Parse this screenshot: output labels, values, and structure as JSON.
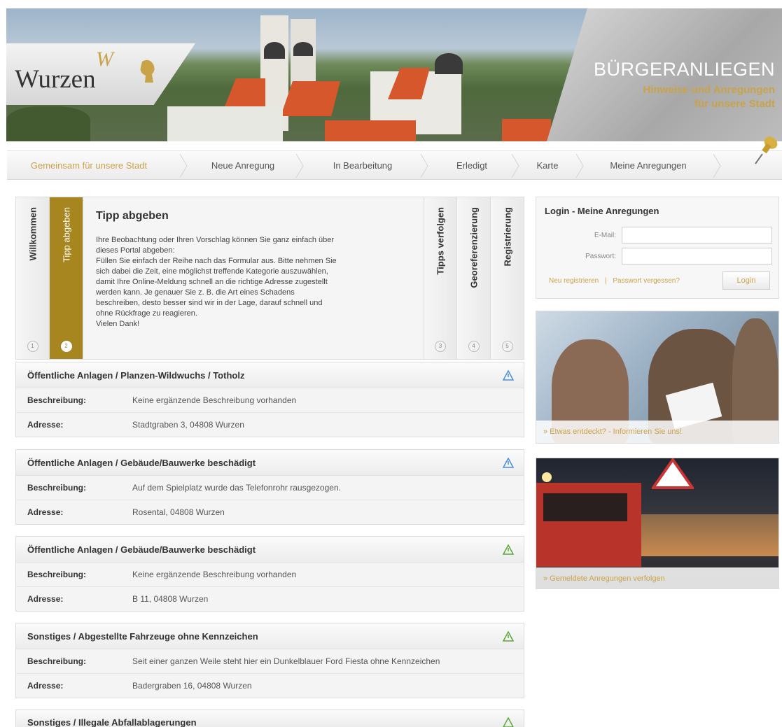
{
  "header": {
    "logo_text": "Wurzen",
    "title": "BÜRGERANLIEGEN",
    "subtitle_1": "Hinweise und Anregungen",
    "subtitle_2": "für unsere Stadt"
  },
  "nav": {
    "items": [
      {
        "label": "Gemeinsam für unsere Stadt",
        "active": true
      },
      {
        "label": "Neue Anregung"
      },
      {
        "label": "In Bearbeitung"
      },
      {
        "label": "Erledigt"
      },
      {
        "label": "Karte"
      },
      {
        "label": "Meine Anregungen"
      }
    ]
  },
  "tabs": {
    "items": [
      {
        "label": "Willkommen",
        "num": "1"
      },
      {
        "label": "Tipp abgeben",
        "num": "2",
        "active": true
      },
      {
        "label": "Tipps verfolgen",
        "num": "3"
      },
      {
        "label": "Georeferenzierung",
        "num": "4"
      },
      {
        "label": "Registrierung",
        "num": "5"
      }
    ],
    "content_title": "Tipp abgeben",
    "content_text": "Ihre Beobachtung oder Ihren Vorschlag können Sie ganz einfach über\ndieses Portal abgeben:\nFüllen Sie einfach der Reihe nach das Formular aus. Bitte nehmen Sie\nsich dabei die Zeit, eine möglichst treffende Kategorie auszuwählen,\ndamit Ihre Online-Meldung schnell an die richtige Adresse zugestellt\nwerden kann. Je genauer Sie z. B. die Art eines Schadens\nbeschreiben, desto besser sind wir in der Lage, darauf schnell und\nohne Rückfrage zu reagieren.\nVielen Dank!"
  },
  "entries": {
    "label_desc": "Beschreibung:",
    "label_addr": "Adresse:",
    "items": [
      {
        "title": "Öffentliche Anlagen / Planzen-Wildwuchs / Totholz",
        "desc": "Keine ergänzende Beschreibung vorhanden",
        "addr": "Stadtgraben 3, 04808 Wurzen",
        "status_color": "#4a90d9"
      },
      {
        "title": "Öffentliche Anlagen / Gebäude/Bauwerke beschädigt",
        "desc": "Auf dem Spielplatz wurde das Telefonrohr rausgezogen.",
        "addr": "Rosental, 04808 Wurzen",
        "status_color": "#4a90d9"
      },
      {
        "title": "Öffentliche Anlagen / Gebäude/Bauwerke beschädigt",
        "desc": "Keine ergänzende Beschreibung vorhanden",
        "addr": "B 11, 04808 Wurzen",
        "status_color": "#5aa83a"
      },
      {
        "title": "Sonstiges / Abgestellte Fahrzeuge ohne Kennzeichen",
        "desc": "Seit einer ganzen Weile steht hier ein Dunkelblauer Ford Fiesta ohne Kennzeichen",
        "addr": "Badergraben 16, 04808 Wurzen",
        "status_color": "#5aa83a"
      },
      {
        "title": "Sonstiges / Illegale Abfallablagerungen",
        "status_color": "#5aa83a"
      }
    ]
  },
  "login": {
    "title": "Login - Meine Anregungen",
    "email_label": "E-Mail:",
    "email_value": "",
    "password_label": "Passwort:",
    "password_value": "",
    "register_link": "Neu registrieren",
    "separator": "|",
    "forgot_link": "Passwort vergessen?",
    "button": "Login"
  },
  "promos": [
    {
      "caption": "» Etwas entdeckt? - Informieren Sie uns!"
    },
    {
      "caption": "» Gemeldete Anregungen verfolgen"
    }
  ],
  "colors": {
    "accent": "#c9a34a",
    "tab_active": "#a7861f"
  }
}
